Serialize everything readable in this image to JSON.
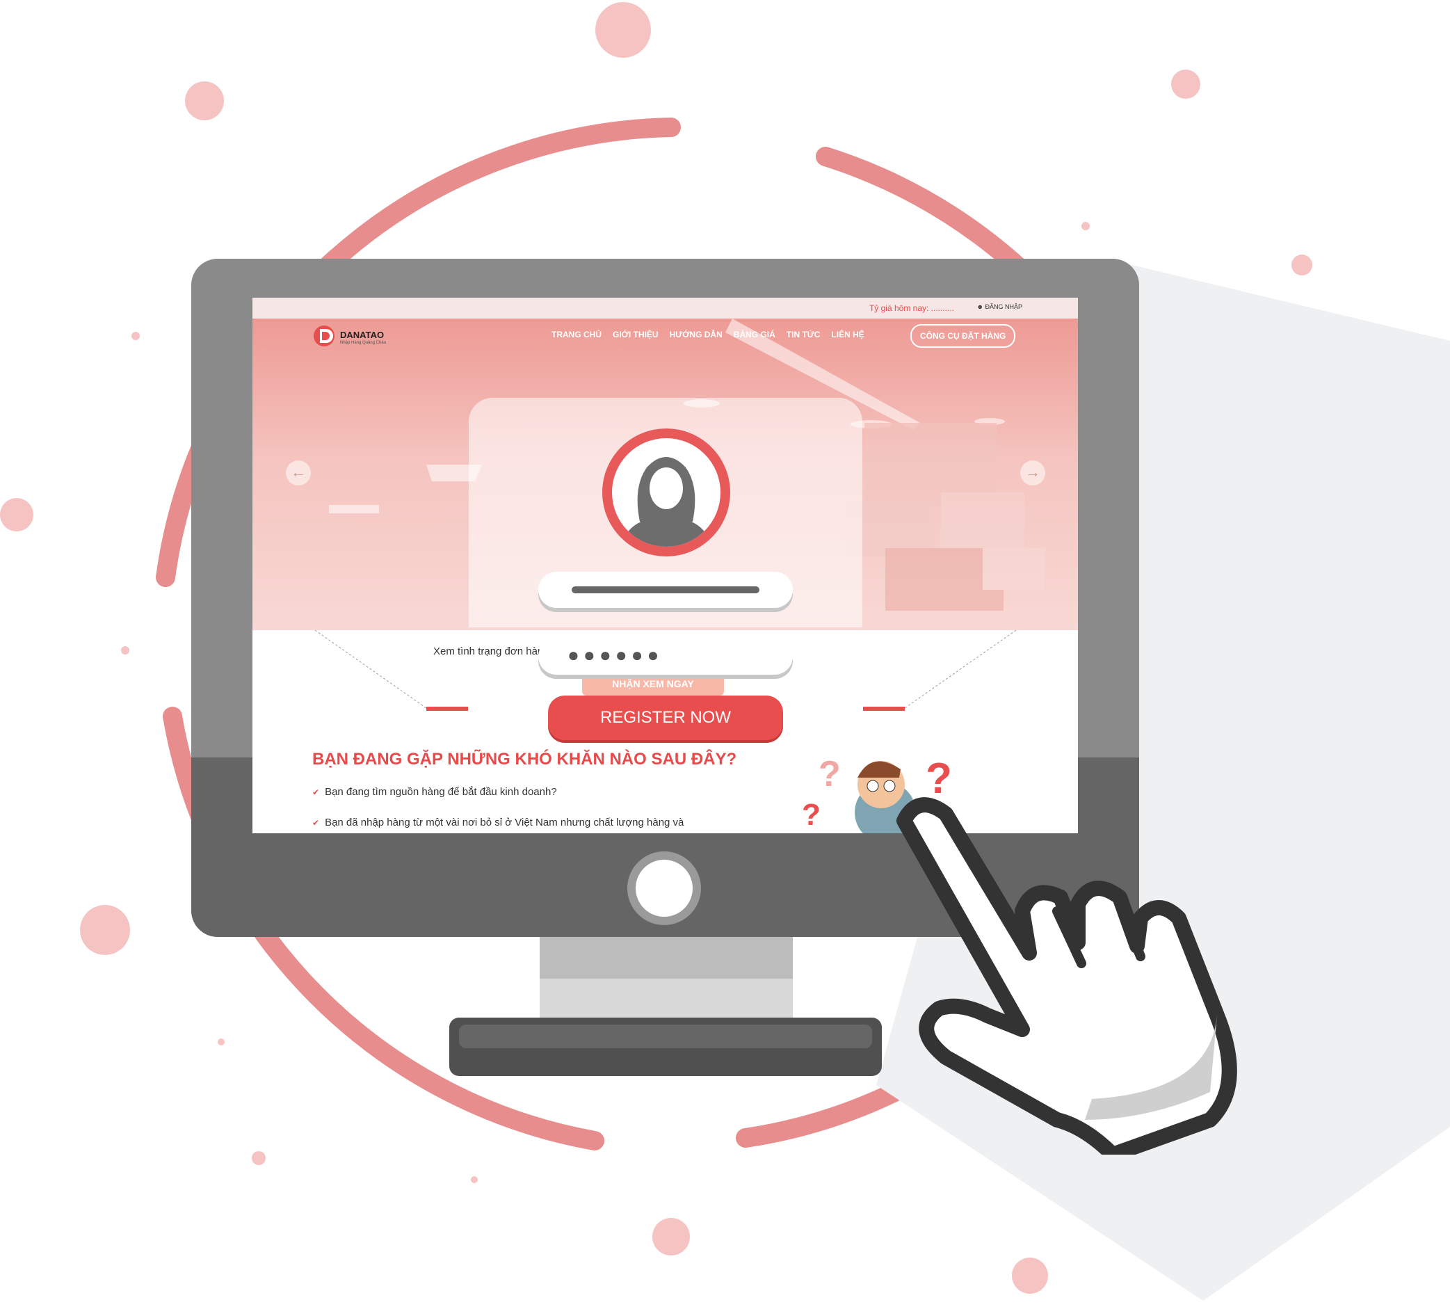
{
  "colors": {
    "accent": "#e84e4e",
    "ring": "#e88d8d",
    "dot": "#f6c3c3",
    "monitor": "#8a8a8a",
    "monitor_chin": "#656565"
  },
  "website": {
    "topbar": {
      "exchange_rate": "Tỷ giá hôm nay: ..........",
      "login": "ĐĂNG NHẬP",
      "login_icon": "user-icon"
    },
    "logo": {
      "name": "DANATAO",
      "tagline": "Nhập Hàng Quảng Châu"
    },
    "nav": {
      "items": [
        "TRANG CHỦ",
        "GIỚI THIỆU",
        "HƯỚNG DẪN",
        "BẢNG GIÁ",
        "TIN TỨC",
        "LIÊN HỆ"
      ],
      "cta": "CÔNG CỤ ĐẶT HÀNG"
    },
    "slider": {
      "prev_icon": "arrow-left-icon",
      "next_icon": "arrow-right-icon"
    },
    "tracking": {
      "text": "Xem tình trạng đơn hàng và sử dụng công cụ đặt hàng.",
      "button": "NHẬN XEM NGAY"
    },
    "section": {
      "title": "BẠN ĐANG GẶP NHỮNG KHÓ KHĂN NÀO SAU ĐÂY?",
      "items": [
        "Bạn đang tìm nguồn hàng để bắt đầu kinh doanh?",
        "Bạn đã nhập hàng từ một vài nơi bỏ sỉ ở Việt Nam nhưng chất lượng hàng và"
      ]
    }
  },
  "login_card": {
    "avatar_icon": "user-avatar-icon",
    "password_mask": "●●●●●●",
    "register_button": "REGISTER NOW"
  },
  "decor": {
    "pointer_icon": "hand-pointer-icon",
    "question_icon": "question-mark-icon"
  }
}
